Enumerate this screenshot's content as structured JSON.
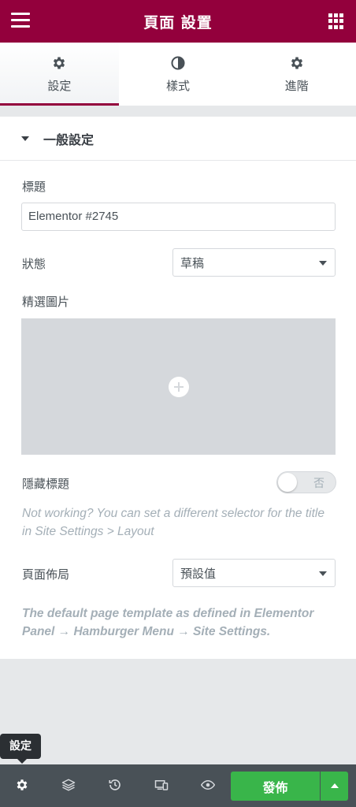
{
  "header": {
    "title": "頁面 設置"
  },
  "tabs": [
    {
      "label": "設定",
      "active": true
    },
    {
      "label": "樣式",
      "active": false
    },
    {
      "label": "進階",
      "active": false
    }
  ],
  "section": {
    "title": "一般設定"
  },
  "fields": {
    "title_label": "標題",
    "title_value": "Elementor #2745",
    "status_label": "狀態",
    "status_value": "草稿",
    "featured_label": "精選圖片",
    "hide_title_label": "隱藏標題",
    "hide_title_toggle": "否",
    "hide_title_note": "Not working? You can set a different selector for the title in Site Settings > Layout",
    "layout_label": "頁面佈局",
    "layout_value": "預設值",
    "layout_note": "The default page template as defined in Elementor Panel → Hamburger Menu → Site Settings."
  },
  "tooltip": "設定",
  "footer": {
    "publish_label": "發佈"
  },
  "colors": {
    "brand": "#93003c",
    "publish": "#39b54a",
    "footer": "#495157"
  }
}
